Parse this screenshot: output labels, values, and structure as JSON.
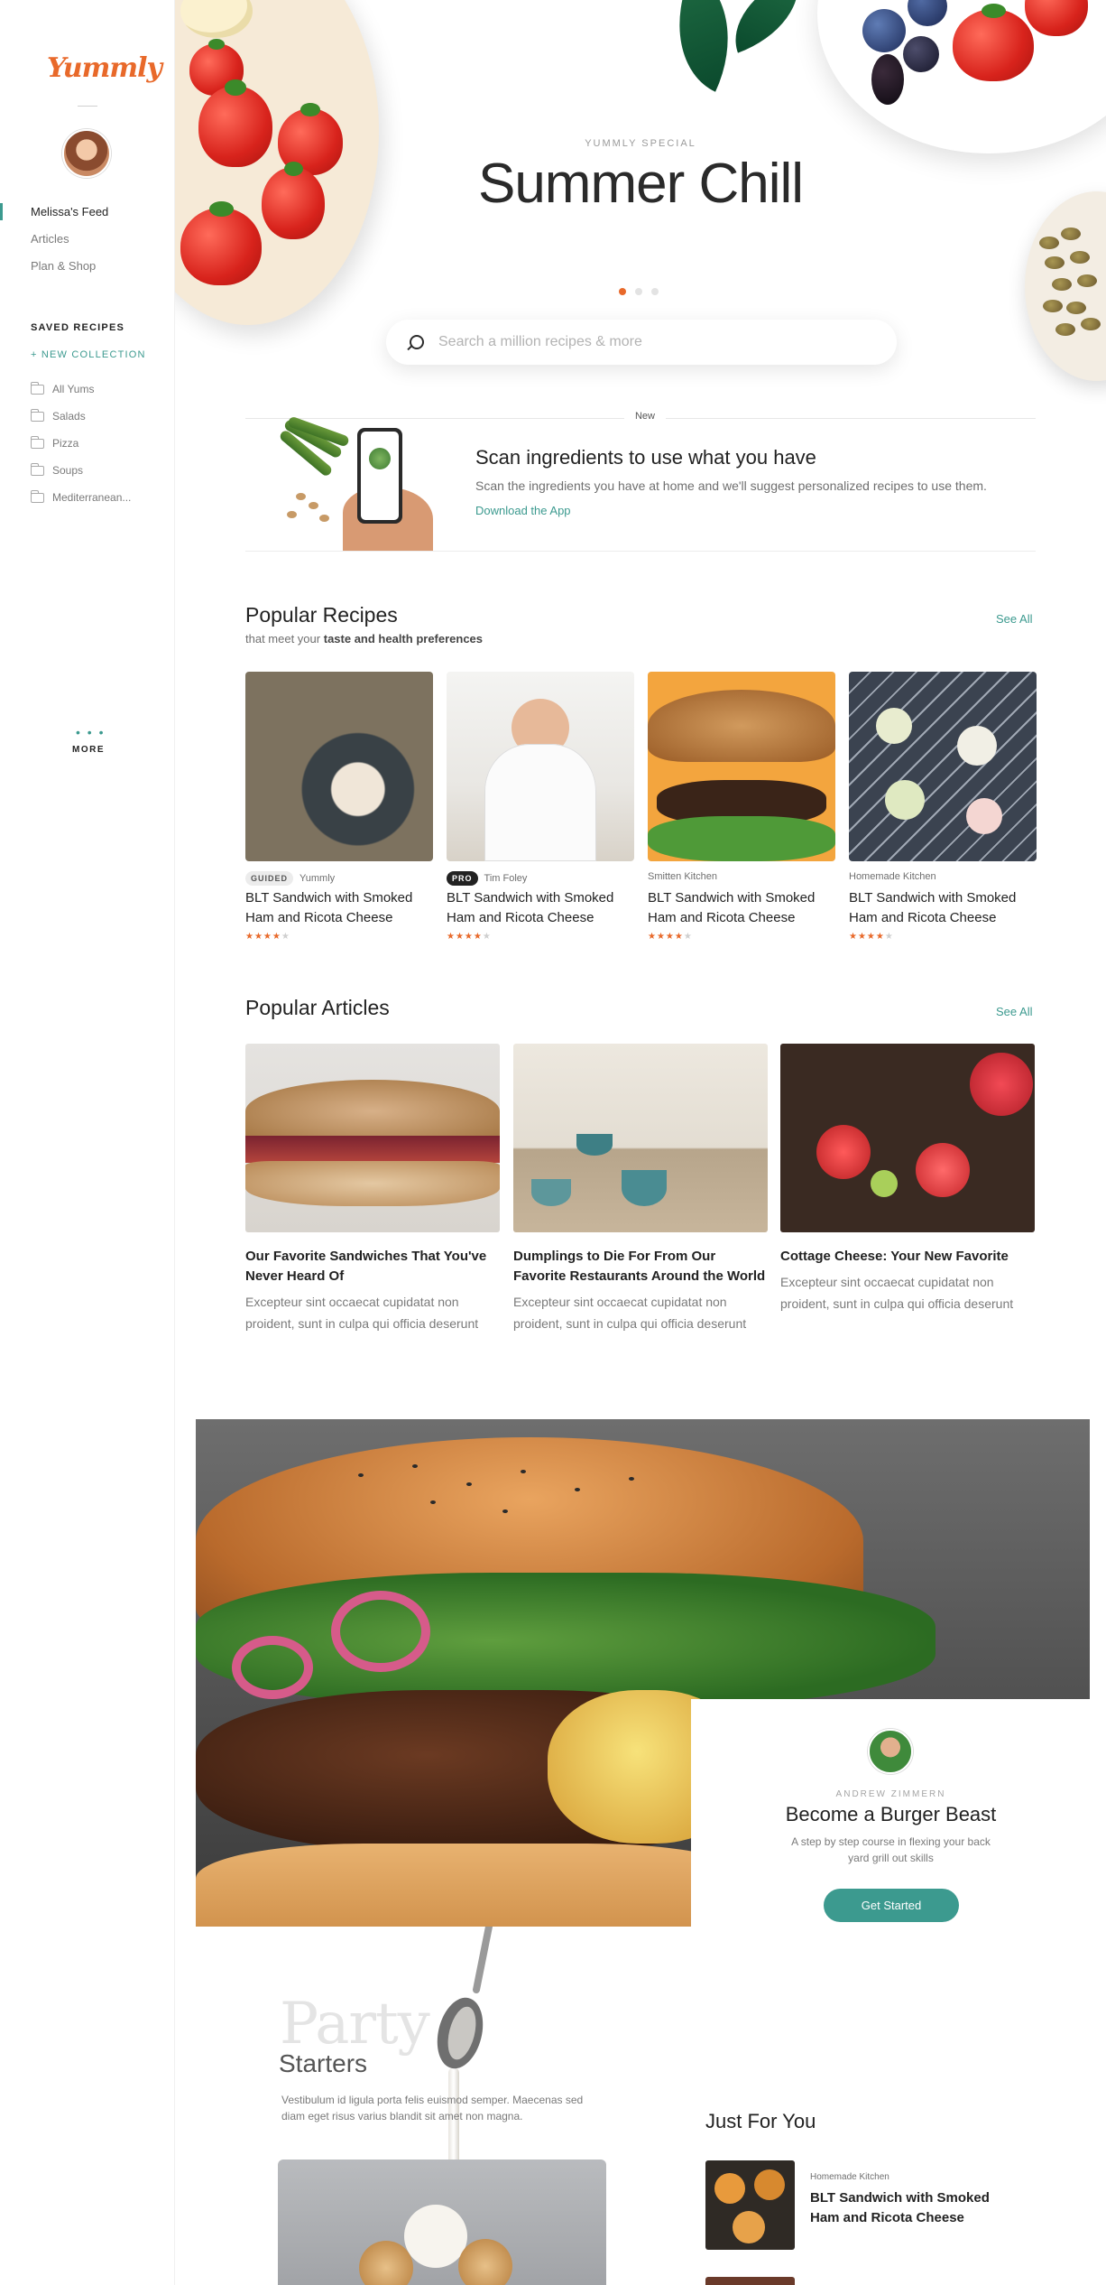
{
  "sidebar": {
    "logo": "Yummly",
    "nav": [
      {
        "label": "Melissa's Feed",
        "active": true
      },
      {
        "label": "Articles",
        "active": false
      },
      {
        "label": "Plan & Shop",
        "active": false
      }
    ],
    "saved_heading": "SAVED RECIPES",
    "new_collection": "+ NEW COLLECTION",
    "collections": [
      "All Yums",
      "Salads",
      "Pizza",
      "Soups",
      "Mediterranean..."
    ],
    "more": "MORE",
    "more_dots": "• • •"
  },
  "hero": {
    "eyebrow": "YUMMLY SPECIAL",
    "title": "Summer Chill",
    "carousel_count": 3,
    "carousel_active": 0,
    "search_placeholder": "Search a million recipes & more"
  },
  "promo": {
    "tag": "New",
    "title": "Scan ingredients to use what you have",
    "description": "Scan the ingredients you have at home and we'll suggest personalized recipes to use them.",
    "link": "Download the App"
  },
  "popular_recipes": {
    "title": "Popular Recipes",
    "subtitle_prefix": "that meet your",
    "subtitle_bold": "taste and health preferences",
    "see_all": "See All",
    "items": [
      {
        "badge": "GUIDED",
        "source": "Yummly",
        "title": "BLT Sandwich with Smoked Ham and Ricota Cheese",
        "rating": 4
      },
      {
        "badge": "PRO",
        "source": "Tim Foley",
        "title": "BLT Sandwich with Smoked Ham and Ricota Cheese",
        "rating": 4
      },
      {
        "badge": "",
        "source": "Smitten Kitchen",
        "title": "BLT Sandwich with Smoked Ham and Ricota Cheese",
        "rating": 4
      },
      {
        "badge": "",
        "source": "Homemade Kitchen",
        "title": "BLT Sandwich with Smoked Ham and Ricota Cheese",
        "rating": 4
      }
    ]
  },
  "popular_articles": {
    "title": "Popular Articles",
    "see_all": "See All",
    "items": [
      {
        "title": "Our Favorite Sandwiches That You've Never Heard Of",
        "desc": "Excepteur sint occaecat cupidatat non proident, sunt in culpa qui officia deserunt"
      },
      {
        "title": "Dumplings to Die For From Our Favorite Restaurants Around the World",
        "desc": "Excepteur sint occaecat cupidatat non proident, sunt in culpa qui officia deserunt"
      },
      {
        "title": "Cottage Cheese: Your New Favorite",
        "desc": "Excepteur sint occaecat cupidatat non proident, sunt in culpa qui officia deserunt"
      }
    ]
  },
  "feature": {
    "eyebrow": "ANDREW ZIMMERN",
    "title": "Become a Burger Beast",
    "description": "A step by step course in flexing your back yard grill out skills",
    "button": "Get Started"
  },
  "party": {
    "script": "Party",
    "title": "Starters",
    "description": "Vestibulum id ligula porta felis euismod semper. Maecenas sed diam eget risus varius blandit sit amet non magna."
  },
  "just_for_you": {
    "title": "Just For You",
    "items": [
      {
        "source": "Homemade Kitchen",
        "title": "BLT Sandwich with Smoked Ham and Ricota Cheese"
      }
    ]
  },
  "colors": {
    "brand": "#e8692a",
    "accent": "#3c9a8f",
    "text": "#222222"
  },
  "stars": {
    "on": "★★★★",
    "off": "★"
  },
  "icons": [
    "search-icon",
    "folder-icon",
    "avatar"
  ]
}
